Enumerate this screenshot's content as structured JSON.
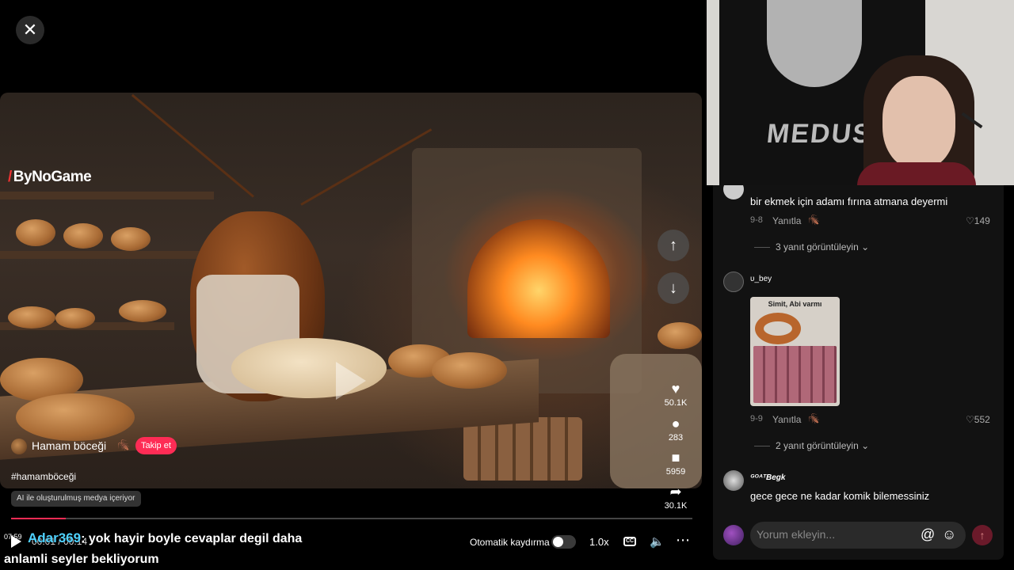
{
  "video": {
    "watermark": "ByNoGame",
    "author": {
      "name": "Hamam böceği",
      "follow_label": "Takip et"
    },
    "hashtag": "#hamamböceği",
    "ai_label": "AI ile oluşturulmuş medya içeriyor",
    "actions": [
      {
        "icon": "heart-icon",
        "count": "50.1K"
      },
      {
        "icon": "comment-icon",
        "count": "283"
      },
      {
        "icon": "bookmark-icon",
        "count": "5959"
      },
      {
        "icon": "share-icon",
        "count": "30.1K"
      }
    ],
    "progress": 0.08,
    "controls": {
      "time": "00:01 / 00:14",
      "autoscroll_label": "Otomatik kaydırma",
      "autoscroll_on": false,
      "speed": "1.0x"
    }
  },
  "chat_overlay": {
    "time": "07:59",
    "user": "Adar369",
    "message": ": yok hayir boyle cevaplar degil daha anlamli seyler bekliyorum"
  },
  "comments": [
    {
      "user": "",
      "text": "bir ekmek için adamı fırına atmana deyermi",
      "date": "9-8",
      "reply_label": "Yanıtla",
      "likes": "149",
      "view_replies": "3 yanıt görüntüleyin"
    },
    {
      "user": "υ_bey",
      "image_caption": "Simit, Abi varmı",
      "date": "9-9",
      "reply_label": "Yanıtla",
      "likes": "552",
      "view_replies": "2 yanıt görüntüleyin"
    },
    {
      "user": "ᴳᴼᴬᵀBegk",
      "text": "gece gece ne kadar komik bilemessiniz"
    }
  ],
  "comment_input": {
    "placeholder": "Yorum ekleyin..."
  },
  "webcam": {
    "tapestry_text": "MEDUS"
  },
  "colors": {
    "accent": "#fe2c55",
    "chat_user": "#4fd2ff",
    "panel_bg": "#121212"
  }
}
